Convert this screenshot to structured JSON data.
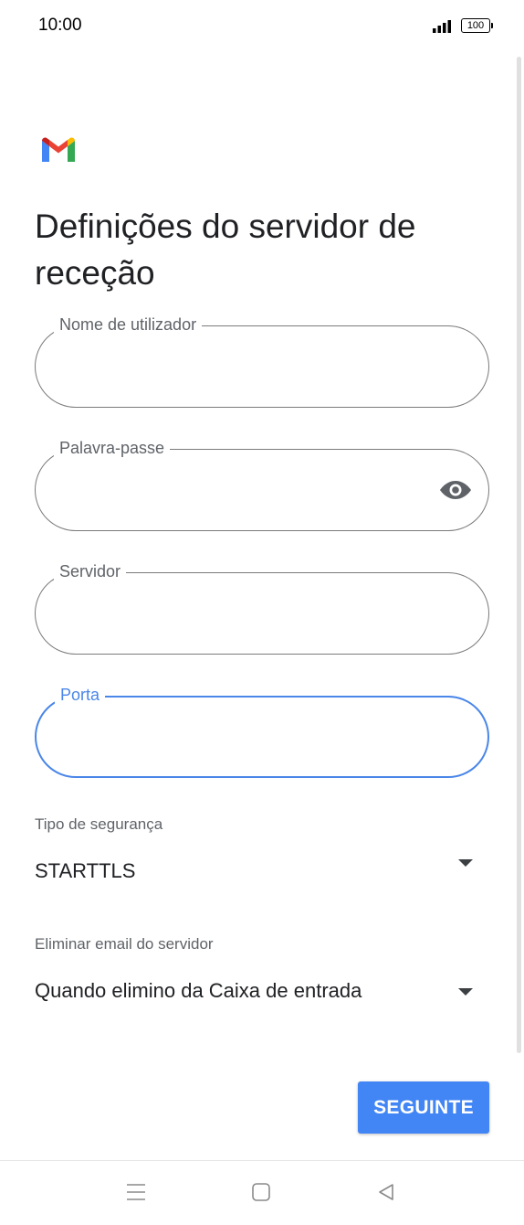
{
  "status_bar": {
    "time": "10:00",
    "battery": "100"
  },
  "title": "Definições do servidor de receção",
  "fields": {
    "username": {
      "label": "Nome de utilizador",
      "value": ""
    },
    "password": {
      "label": "Palavra-passe",
      "value": ""
    },
    "server": {
      "label": "Servidor",
      "value": ""
    },
    "port": {
      "label": "Porta",
      "value": ""
    }
  },
  "security": {
    "label": "Tipo de segurança",
    "value": "STARTTLS"
  },
  "delete_from_server": {
    "label": "Eliminar email do servidor",
    "value": "Quando elimino da Caixa de entrada"
  },
  "next_button": {
    "label": "SEGUINTE"
  },
  "colors": {
    "accent": "#4285f4",
    "focus": "#4a86e8",
    "text": "#202124",
    "secondary_text": "#5f6368"
  },
  "icons": {
    "logo": "gmail-logo-icon",
    "password_toggle": "eye-icon",
    "dropdown": "dropdown-arrow-icon",
    "nav": [
      "menu-icon",
      "home-icon",
      "back-icon"
    ]
  }
}
